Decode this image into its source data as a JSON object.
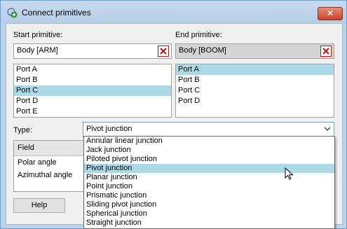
{
  "window": {
    "title": "Connect primitives",
    "close_label": "✕",
    "icon": "connect-primitives-icon"
  },
  "start": {
    "label": "Start primitive:",
    "value": "Body [ARM]",
    "clear_icon": "red-x-icon",
    "ports": [
      "Port A",
      "Port B",
      "Port C",
      "Port D",
      "Port E"
    ],
    "selected_port": "Port C"
  },
  "end": {
    "label": "End primitive:",
    "value": "Body [BOOM]",
    "clear_icon": "red-x-icon",
    "ports": [
      "Port A",
      "Port B",
      "Port C",
      "Port D"
    ],
    "selected_port": "Port A"
  },
  "type": {
    "label": "Type:",
    "value": "Pivot junction",
    "options": [
      "Annular linear junction",
      "Jack junction",
      "Piloted pivot junction",
      "Pivot junction",
      "Planar junction",
      "Point junction",
      "Prismatic junction",
      "Sliding pivot junction",
      "Spherical junction",
      "Straight junction"
    ],
    "highlighted_option": "Pivot junction"
  },
  "fields": {
    "header": "Field",
    "rows": [
      "Polar angle",
      "Azimuthal angle"
    ]
  },
  "buttons": {
    "help": "Help"
  },
  "colors": {
    "selection": "#add8e6",
    "close_red": "#c7432e",
    "clear_x_red": "#c01818"
  }
}
